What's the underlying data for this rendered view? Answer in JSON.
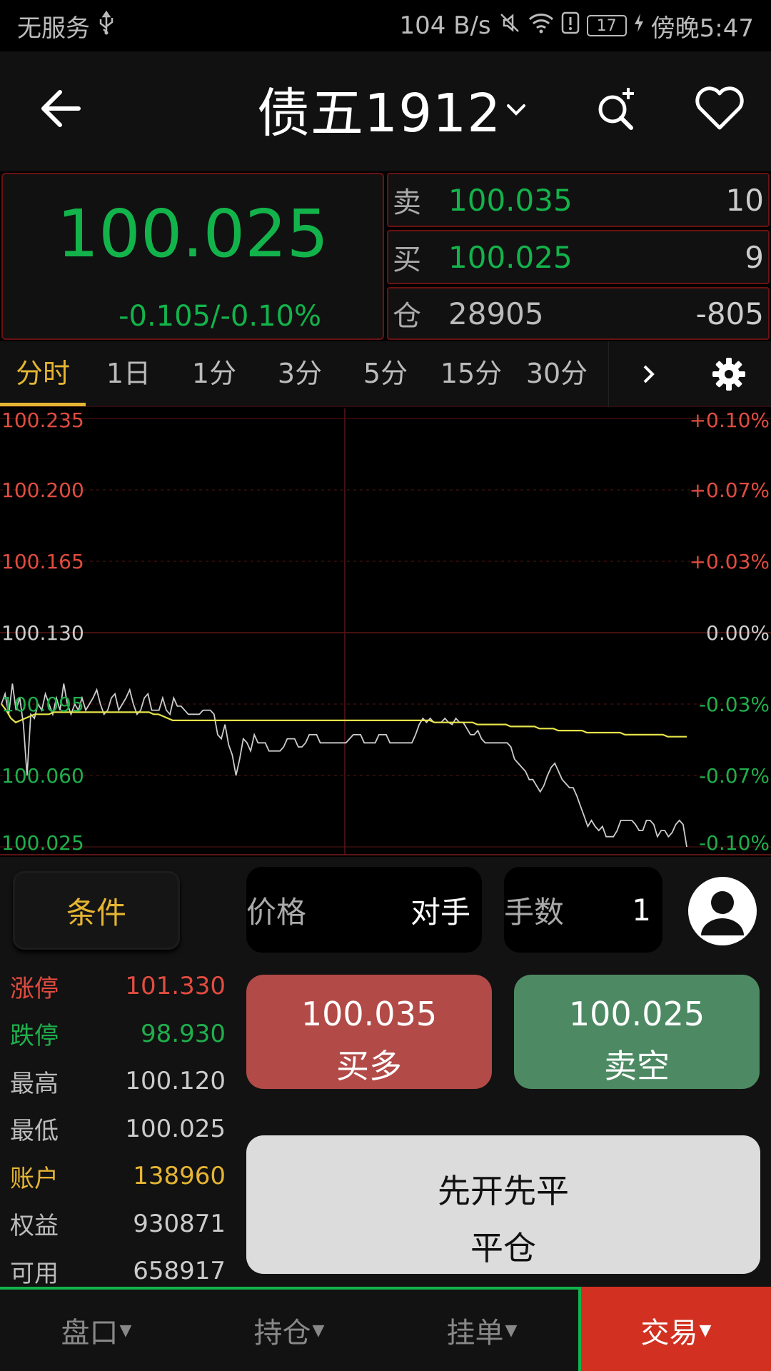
{
  "status_bar": {
    "carrier": "无服务",
    "speed": "104 B/s",
    "battery": "17",
    "time": "傍晚5:47"
  },
  "header": {
    "title": "债五1912"
  },
  "quote": {
    "last_price": "100.025",
    "change": "-0.105/-0.10%",
    "book": [
      {
        "label": "卖",
        "price": "100.035",
        "volume": "10"
      },
      {
        "label": "买",
        "price": "100.025",
        "volume": "9"
      },
      {
        "label": "仓",
        "price": "28905",
        "volume": "-805"
      }
    ]
  },
  "tabs": [
    {
      "label": "分时",
      "active": true
    },
    {
      "label": "1日",
      "active": false
    },
    {
      "label": "1分",
      "active": false
    },
    {
      "label": "3分",
      "active": false
    },
    {
      "label": "5分",
      "active": false
    },
    {
      "label": "15分",
      "active": false
    },
    {
      "label": "30分",
      "active": false
    }
  ],
  "chart_data": {
    "type": "line",
    "y_left_ticks": [
      "100.235",
      "100.200",
      "100.165",
      "100.130",
      "100.095",
      "100.060",
      "100.025"
    ],
    "y_right_ticks": [
      "+0.10%",
      "+0.07%",
      "+0.03%",
      "0.00%",
      "-0.03%",
      "-0.07%",
      "-0.10%"
    ],
    "ylim": [
      100.025,
      100.235
    ],
    "reference_price": 100.13,
    "colors": {
      "up": "#e04c40",
      "down": "#1fae4c",
      "flat": "#cccccc",
      "price_line": "#cccccc",
      "avg_line": "#e6e44a",
      "grid": "#5a1515"
    },
    "series": [
      {
        "role": "price",
        "values": [
          100.095,
          100.1,
          100.09,
          100.105,
          100.092,
          100.098,
          100.085,
          100.06,
          100.09,
          100.088,
          100.095,
          100.092,
          100.1,
          100.095,
          100.09,
          100.098,
          100.092,
          100.105,
          100.095,
          100.09,
          100.095,
          100.092,
          100.098,
          100.092,
          100.095,
          100.098,
          100.102,
          100.095,
          100.09,
          100.092,
          100.098,
          100.1,
          100.092,
          100.095,
          100.098,
          100.102,
          100.095,
          100.09,
          100.092,
          100.098,
          100.1,
          100.092,
          100.092,
          100.092,
          100.098,
          100.092,
          100.09,
          100.098,
          100.094,
          100.094,
          100.092,
          100.09,
          100.09,
          100.09,
          100.09,
          100.092,
          100.092,
          100.092,
          100.09,
          100.08,
          100.078,
          100.085,
          100.075,
          100.07,
          100.06,
          100.068,
          100.078,
          100.076,
          100.072,
          100.08,
          100.076,
          100.076,
          100.076,
          100.072,
          100.072,
          100.072,
          100.072,
          100.074,
          100.078,
          100.078,
          100.078,
          100.074,
          100.074,
          100.076,
          100.08,
          100.08,
          100.08,
          100.076,
          100.076,
          100.076,
          100.076,
          100.076,
          100.076,
          100.076,
          100.076,
          100.078,
          100.08,
          100.08,
          100.08,
          100.076,
          100.076,
          100.076,
          100.076,
          100.08,
          100.08,
          100.08,
          100.076,
          100.076,
          100.076,
          100.076,
          100.076,
          100.076,
          100.076,
          100.08,
          100.085,
          100.088,
          100.086,
          100.088,
          100.086,
          100.086,
          100.086,
          100.088,
          100.086,
          100.085,
          100.088,
          100.086,
          100.086,
          100.083,
          100.08,
          100.08,
          100.082,
          100.078,
          100.076,
          100.076,
          100.076,
          100.076,
          100.076,
          100.076,
          100.076,
          100.074,
          100.068,
          100.066,
          100.064,
          100.062,
          100.058,
          100.058,
          100.055,
          100.052,
          100.055,
          100.06,
          100.064,
          100.066,
          100.062,
          100.058,
          100.056,
          100.054,
          100.054,
          100.05,
          100.045,
          100.04,
          100.035,
          100.038,
          100.035,
          100.033,
          100.035,
          100.03,
          100.03,
          100.03,
          100.033,
          100.038,
          100.038,
          100.038,
          100.038,
          100.036,
          100.033,
          100.033,
          100.038,
          100.038,
          100.036,
          100.03,
          100.033,
          100.033,
          100.03,
          100.032,
          100.036,
          100.038,
          100.036,
          100.025
        ]
      },
      {
        "role": "average",
        "values": [
          100.095,
          100.092,
          100.088,
          100.086,
          100.087,
          100.088,
          100.089,
          100.09,
          100.09,
          100.09,
          100.09,
          100.091,
          100.091,
          100.091,
          100.091,
          100.091,
          100.091,
          100.091,
          100.091,
          100.091,
          100.091,
          100.091,
          100.091,
          100.091,
          100.091,
          100.091,
          100.091,
          100.091,
          100.091,
          100.091,
          100.091,
          100.091,
          100.09,
          100.09,
          100.089,
          100.088,
          100.087,
          100.087,
          100.087,
          100.087,
          100.087,
          100.087,
          100.087,
          100.087,
          100.087,
          100.087,
          100.087,
          100.087,
          100.087,
          100.087,
          100.087,
          100.087,
          100.087,
          100.087,
          100.087,
          100.087,
          100.087,
          100.087,
          100.087,
          100.087,
          100.087,
          100.087,
          100.087,
          100.087,
          100.087,
          100.087,
          100.087,
          100.087,
          100.087,
          100.087,
          100.087,
          100.087,
          100.087,
          100.087,
          100.087,
          100.087,
          100.087,
          100.087,
          100.087,
          100.087,
          100.087,
          100.087,
          100.087,
          100.087,
          100.087,
          100.087,
          100.087,
          100.087,
          100.087,
          100.087,
          100.087,
          100.086,
          100.086,
          100.086,
          100.086,
          100.086,
          100.086,
          100.086,
          100.086,
          100.086,
          100.085,
          100.085,
          100.085,
          100.085,
          100.085,
          100.085,
          100.085,
          100.084,
          100.084,
          100.084,
          100.084,
          100.084,
          100.084,
          100.083,
          100.083,
          100.083,
          100.083,
          100.082,
          100.082,
          100.082,
          100.082,
          100.082,
          100.082,
          100.081,
          100.081,
          100.081,
          100.081,
          100.081,
          100.081,
          100.081,
          100.081,
          100.08,
          100.08,
          100.08,
          100.08,
          100.08,
          100.08,
          100.08,
          100.08,
          100.08,
          100.079,
          100.079,
          100.079,
          100.079,
          100.079
        ]
      }
    ]
  },
  "trade": {
    "condition_label": "条件",
    "price_label": "价格",
    "price_value": "对手",
    "qty_label": "手数",
    "qty_value": "1",
    "buy_price": "100.035",
    "buy_label": "买多",
    "sell_price": "100.025",
    "sell_label": "卖空",
    "close_line1": "先开先平",
    "close_line2": "平仓",
    "stats": [
      {
        "label": "涨停",
        "value": "101.330",
        "color": "#e04c40",
        "label_color": "#e04c40"
      },
      {
        "label": "跌停",
        "value": "98.930",
        "color": "#1fae4c",
        "label_color": "#1fae4c"
      },
      {
        "label": "最高",
        "value": "100.120",
        "color": "#cccccc",
        "label_color": "#bbbbbb"
      },
      {
        "label": "最低",
        "value": "100.025",
        "color": "#cccccc",
        "label_color": "#bbbbbb"
      },
      {
        "label": "账户",
        "value": "138960",
        "color": "#e5b532",
        "label_color": "#e5b532"
      },
      {
        "label": "权益",
        "value": "930871",
        "color": "#cccccc",
        "label_color": "#bbbbbb"
      },
      {
        "label": "可用",
        "value": "658917",
        "color": "#cccccc",
        "label_color": "#bbbbbb"
      }
    ]
  },
  "bottom_nav": [
    {
      "label": "盘口",
      "active": false
    },
    {
      "label": "持仓",
      "active": false
    },
    {
      "label": "挂单",
      "active": false
    },
    {
      "label": "交易",
      "active": true
    }
  ]
}
